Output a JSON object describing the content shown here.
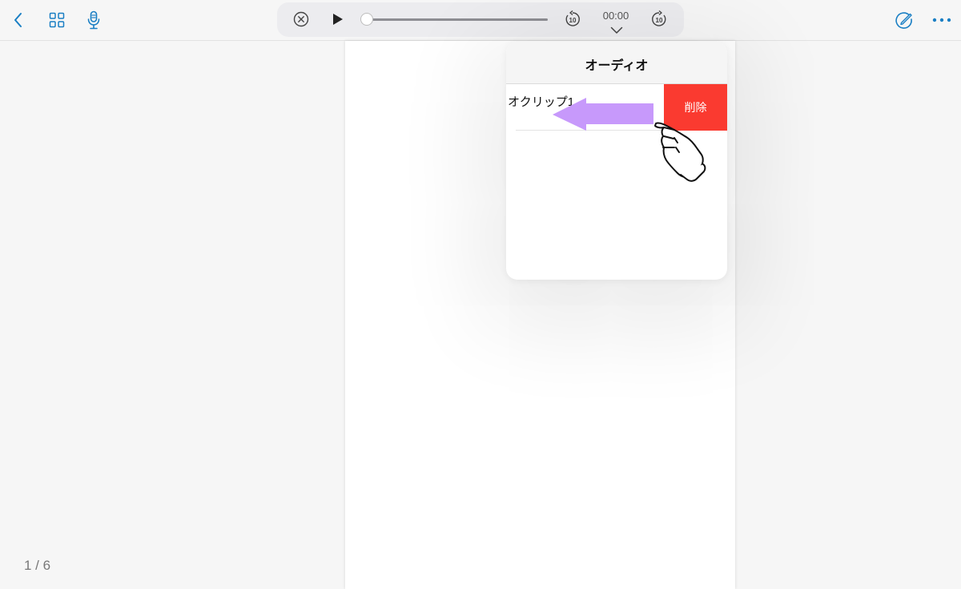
{
  "colors": {
    "accent": "#1a7fc4",
    "delete": "#fa3a30",
    "arrow": "#c799fb"
  },
  "toolbar": {
    "back_icon": "chevron-left-icon",
    "grid_icon": "grid-icon",
    "mic_icon": "microphone-icon",
    "pencil_icon": "pencil-circle-icon",
    "more_icon": "ellipsis-icon"
  },
  "player": {
    "close_icon": "close-circle-icon",
    "play_icon": "play-icon",
    "skip_back_label": "10",
    "skip_forward_label": "10",
    "time": "00:00",
    "progress": 0
  },
  "popover": {
    "title": "オーディオ",
    "clips": [
      {
        "name": "オクリップ1"
      }
    ],
    "delete_label": "削除"
  },
  "annotation": {
    "arrow_icon": "swipe-left-arrow-icon",
    "hand_icon": "pointing-hand-icon"
  },
  "footer": {
    "page_count": "1 / 6"
  }
}
